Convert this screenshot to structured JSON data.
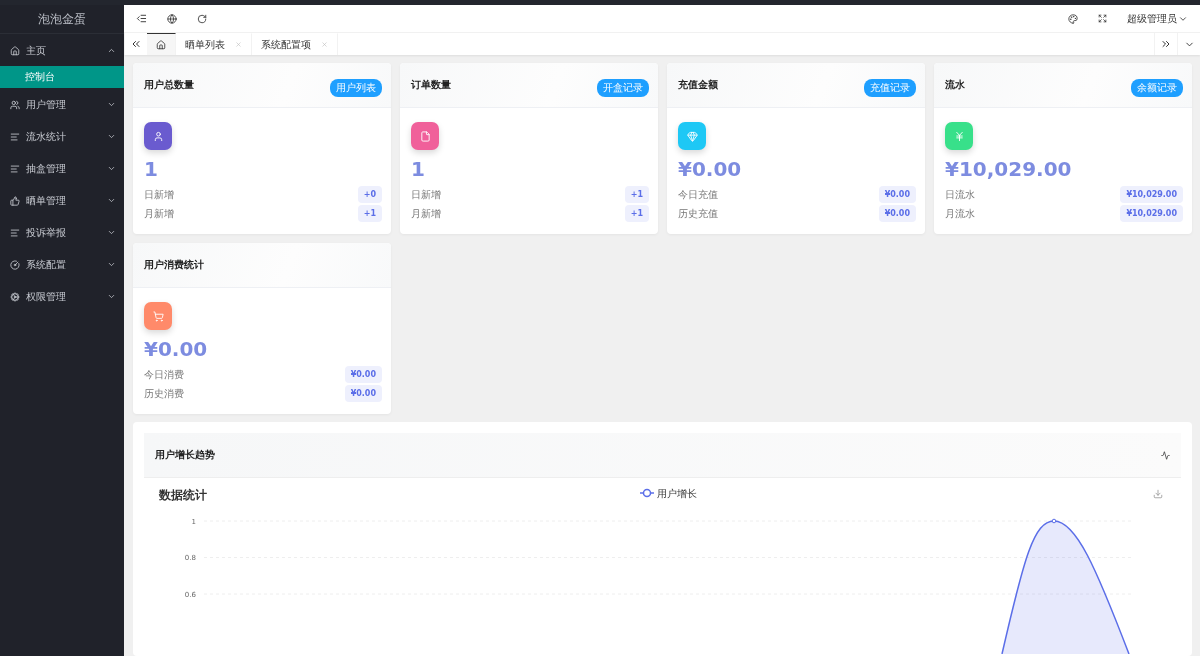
{
  "sidebar": {
    "title": "泡泡金蛋",
    "items": [
      {
        "label": "主页",
        "expanded": true,
        "children": [
          {
            "label": "控制台",
            "selected": true
          }
        ]
      },
      {
        "label": "用户管理",
        "expanded": false
      },
      {
        "label": "流水统计",
        "expanded": false
      },
      {
        "label": "抽盒管理",
        "expanded": false
      },
      {
        "label": "晒单管理",
        "expanded": false
      },
      {
        "label": "投诉举报",
        "expanded": false
      },
      {
        "label": "系统配置",
        "expanded": false
      },
      {
        "label": "权限管理",
        "expanded": false
      }
    ]
  },
  "header": {
    "user": "超级管理员"
  },
  "tabs": [
    {
      "kind": "home",
      "selected": true
    },
    {
      "kind": "page",
      "label": "晒单列表",
      "selected": false
    },
    {
      "kind": "page",
      "label": "系统配置项",
      "selected": false
    }
  ],
  "stat_cards": [
    {
      "title": "用户总数量",
      "button": "用户列表",
      "color": "#6a5bcf",
      "value": "1",
      "rows": [
        {
          "label": "日新增",
          "value": "+0"
        },
        {
          "label": "月新增",
          "value": "+1"
        }
      ]
    },
    {
      "title": "订单数量",
      "button": "开盒记录",
      "color": "#f0609a",
      "value": "1",
      "rows": [
        {
          "label": "日新增",
          "value": "+1"
        },
        {
          "label": "月新增",
          "value": "+1"
        }
      ]
    },
    {
      "title": "充值金额",
      "button": "充值记录",
      "color": "#1ec8f5",
      "value": "¥0.00",
      "rows": [
        {
          "label": "今日充值",
          "value": "¥0.00"
        },
        {
          "label": "历史充值",
          "value": "¥0.00"
        }
      ]
    },
    {
      "title": "流水",
      "button": "余额记录",
      "color": "#38e08a",
      "value": "¥10,029.00",
      "rows": [
        {
          "label": "日流水",
          "value": "¥10,029.00"
        },
        {
          "label": "月流水",
          "value": "¥10,029.00"
        }
      ]
    },
    {
      "title": "用户消费统计",
      "color": "#ff8a6a",
      "value": "¥0.00",
      "rows": [
        {
          "label": "今日消费",
          "value": "¥0.00"
        },
        {
          "label": "历史消费",
          "value": "¥0.00"
        }
      ]
    }
  ],
  "trend": {
    "title": "用户增长趋势",
    "chart_title": "数据统计",
    "legend": "用户增长",
    "y_labels": [
      "1",
      "0.8",
      "0.6"
    ]
  }
}
